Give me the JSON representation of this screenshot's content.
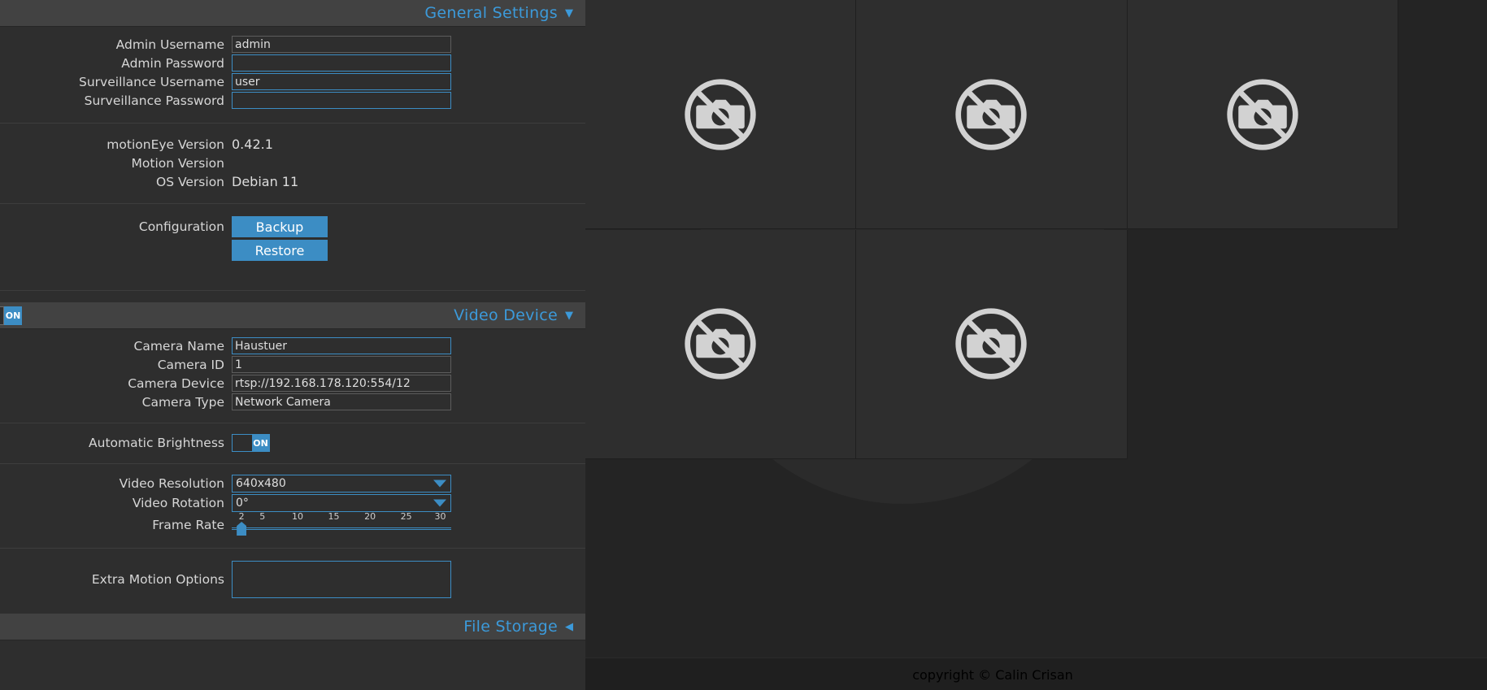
{
  "app": {
    "copyright": "copyright © Calin Crisan"
  },
  "general_settings": {
    "title": "General Settings",
    "caret": "▼",
    "fields": [
      {
        "label": "Admin Username",
        "value": "admin",
        "placeholder": ""
      },
      {
        "label": "Admin Password",
        "value": "",
        "placeholder": ""
      },
      {
        "label": "Surveillance Username",
        "value": "user",
        "placeholder": ""
      },
      {
        "label": "Surveillance Password",
        "value": "",
        "placeholder": ""
      }
    ],
    "versions": [
      {
        "label": "motionEye Version",
        "value": "0.42.1"
      },
      {
        "label": "Motion Version",
        "value": ""
      },
      {
        "label": "OS Version",
        "value": "Debian 11"
      }
    ],
    "configuration": {
      "label": "Configuration",
      "backup_label": "Backup",
      "restore_label": "Restore"
    }
  },
  "video_device": {
    "title": "Video Device",
    "caret": "▼",
    "enabled_label": "ON",
    "fields": [
      {
        "label": "Camera Name",
        "value": "Haustuer"
      },
      {
        "label": "Camera ID",
        "value": "1"
      },
      {
        "label": "Camera Device",
        "value": "rtsp://192.168.178.120:554/12"
      },
      {
        "label": "Camera Type",
        "value": "Network Camera"
      }
    ],
    "automatic_brightness": {
      "label": "Automatic Brightness",
      "state": "ON"
    },
    "video_resolution": {
      "label": "Video Resolution",
      "value": "640x480"
    },
    "video_rotation": {
      "label": "Video Rotation",
      "value": "0°"
    },
    "frame_rate": {
      "label": "Frame Rate",
      "value": 2,
      "min": 2,
      "max": 30,
      "ticks": [
        "2",
        "5",
        "10",
        "15",
        "20",
        "25",
        "30"
      ]
    },
    "extra_motion_options": {
      "label": "Extra Motion Options",
      "value": ""
    }
  },
  "file_storage": {
    "title": "File Storage",
    "caret": "◀"
  },
  "cameras": {
    "placeholder_icon": "no-camera-icon",
    "cells": [
      {
        "state": "no-signal"
      },
      {
        "state": "no-signal"
      },
      {
        "state": "no-signal"
      },
      {
        "state": "no-signal"
      },
      {
        "state": "no-signal"
      },
      {
        "state": "empty"
      }
    ]
  },
  "colors": {
    "accent": "#3c8dc4",
    "link": "#3c9ada",
    "panel_bg": "#2e2e2e",
    "header_bg": "#424242",
    "page_bg": "#242424"
  }
}
